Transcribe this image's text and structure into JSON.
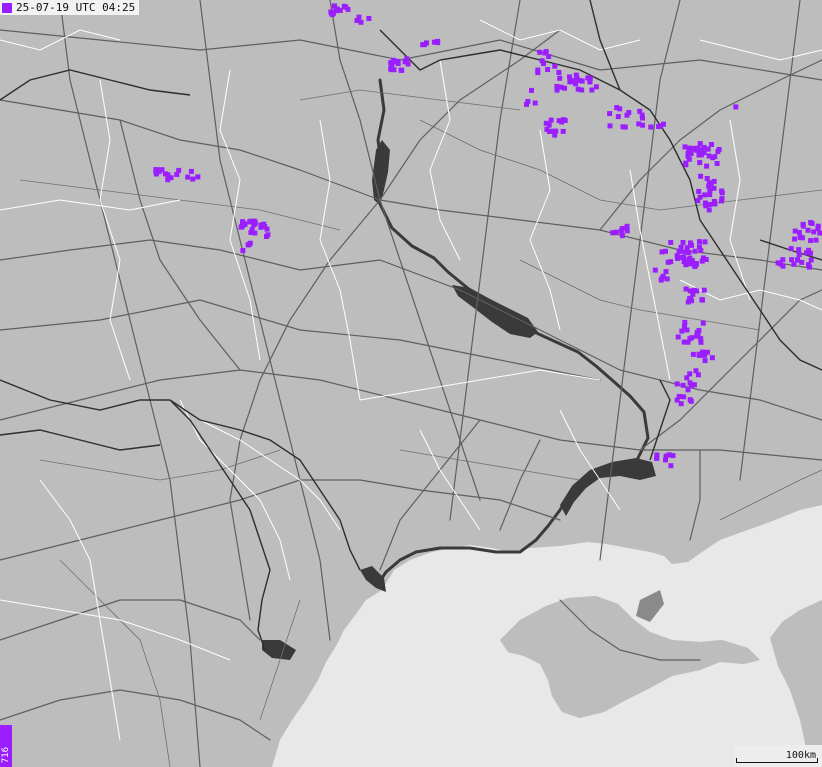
{
  "header": {
    "timestamp": "25-07-19 UTC 04:25"
  },
  "legend": {
    "count": "716"
  },
  "scale": {
    "label": "100km"
  },
  "colors": {
    "land": "#bdbdbd",
    "sea": "#e8e8e8",
    "water": "#3a3a3a",
    "roads": "#5f5f5f",
    "borders": "#ffffff",
    "national_borders": "#333333",
    "lightning": "#9b1eff"
  },
  "icons": {
    "strike_marker": "square-marker"
  }
}
